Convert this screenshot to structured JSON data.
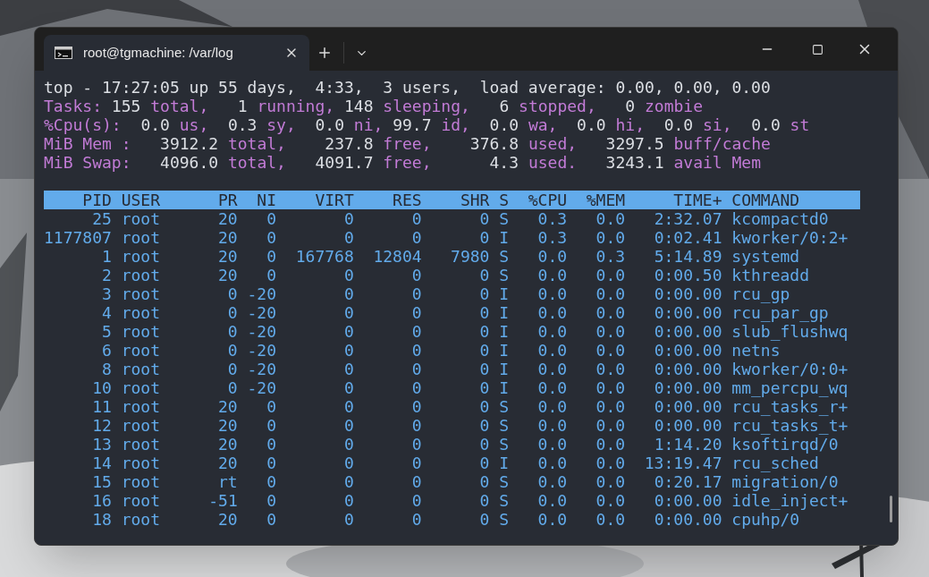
{
  "window": {
    "tab_title": "root@tgmachine: /var/log"
  },
  "summary": [
    {
      "segments": [
        {
          "kind": "value",
          "text": "top - 17:27:05 up 55 days,  4:33,  3 users,  load average: 0.00, 0.00, 0.00"
        }
      ]
    },
    {
      "segments": [
        {
          "kind": "label",
          "text": "Tasks:"
        },
        {
          "kind": "value",
          "text": " 155 "
        },
        {
          "kind": "label",
          "text": "total,"
        },
        {
          "kind": "value",
          "text": "   1 "
        },
        {
          "kind": "label",
          "text": "running,"
        },
        {
          "kind": "value",
          "text": " 148 "
        },
        {
          "kind": "label",
          "text": "sleeping,"
        },
        {
          "kind": "value",
          "text": "   6 "
        },
        {
          "kind": "label",
          "text": "stopped,"
        },
        {
          "kind": "value",
          "text": "   0 "
        },
        {
          "kind": "label",
          "text": "zombie"
        }
      ]
    },
    {
      "segments": [
        {
          "kind": "label",
          "text": "%Cpu(s):"
        },
        {
          "kind": "value",
          "text": "  0.0 "
        },
        {
          "kind": "label",
          "text": "us,"
        },
        {
          "kind": "value",
          "text": "  0.3 "
        },
        {
          "kind": "label",
          "text": "sy,"
        },
        {
          "kind": "value",
          "text": "  0.0 "
        },
        {
          "kind": "label",
          "text": "ni,"
        },
        {
          "kind": "value",
          "text": " 99.7 "
        },
        {
          "kind": "label",
          "text": "id,"
        },
        {
          "kind": "value",
          "text": "  0.0 "
        },
        {
          "kind": "label",
          "text": "wa,"
        },
        {
          "kind": "value",
          "text": "  0.0 "
        },
        {
          "kind": "label",
          "text": "hi,"
        },
        {
          "kind": "value",
          "text": "  0.0 "
        },
        {
          "kind": "label",
          "text": "si,"
        },
        {
          "kind": "value",
          "text": "  0.0 "
        },
        {
          "kind": "label",
          "text": "st"
        }
      ]
    },
    {
      "segments": [
        {
          "kind": "label",
          "text": "MiB Mem :"
        },
        {
          "kind": "value",
          "text": "   3912.2 "
        },
        {
          "kind": "label",
          "text": "total,"
        },
        {
          "kind": "value",
          "text": "    237.8 "
        },
        {
          "kind": "label",
          "text": "free,"
        },
        {
          "kind": "value",
          "text": "    376.8 "
        },
        {
          "kind": "label",
          "text": "used,"
        },
        {
          "kind": "value",
          "text": "   3297.5 "
        },
        {
          "kind": "label",
          "text": "buff/cache"
        }
      ]
    },
    {
      "segments": [
        {
          "kind": "label",
          "text": "MiB Swap:"
        },
        {
          "kind": "value",
          "text": "   4096.0 "
        },
        {
          "kind": "label",
          "text": "total,"
        },
        {
          "kind": "value",
          "text": "   4091.7 "
        },
        {
          "kind": "label",
          "text": "free,"
        },
        {
          "kind": "value",
          "text": "      4.3 "
        },
        {
          "kind": "label",
          "text": "used."
        },
        {
          "kind": "value",
          "text": "   3243.1 "
        },
        {
          "kind": "label",
          "text": "avail Mem"
        }
      ]
    }
  ],
  "table": {
    "columns": [
      "PID",
      "USER",
      "PR",
      "NI",
      "VIRT",
      "RES",
      "SHR",
      "S",
      "%CPU",
      "%MEM",
      "TIME+",
      "COMMAND"
    ],
    "rows": [
      [
        "25",
        "root",
        "20",
        "0",
        "0",
        "0",
        "0",
        "S",
        "0.3",
        "0.0",
        "2:32.07",
        "kcompactd0"
      ],
      [
        "1177807",
        "root",
        "20",
        "0",
        "0",
        "0",
        "0",
        "I",
        "0.3",
        "0.0",
        "0:02.41",
        "kworker/0:2+"
      ],
      [
        "1",
        "root",
        "20",
        "0",
        "167768",
        "12804",
        "7980",
        "S",
        "0.0",
        "0.3",
        "5:14.89",
        "systemd"
      ],
      [
        "2",
        "root",
        "20",
        "0",
        "0",
        "0",
        "0",
        "S",
        "0.0",
        "0.0",
        "0:00.50",
        "kthreadd"
      ],
      [
        "3",
        "root",
        "0",
        "-20",
        "0",
        "0",
        "0",
        "I",
        "0.0",
        "0.0",
        "0:00.00",
        "rcu_gp"
      ],
      [
        "4",
        "root",
        "0",
        "-20",
        "0",
        "0",
        "0",
        "I",
        "0.0",
        "0.0",
        "0:00.00",
        "rcu_par_gp"
      ],
      [
        "5",
        "root",
        "0",
        "-20",
        "0",
        "0",
        "0",
        "I",
        "0.0",
        "0.0",
        "0:00.00",
        "slub_flushwq"
      ],
      [
        "6",
        "root",
        "0",
        "-20",
        "0",
        "0",
        "0",
        "I",
        "0.0",
        "0.0",
        "0:00.00",
        "netns"
      ],
      [
        "8",
        "root",
        "0",
        "-20",
        "0",
        "0",
        "0",
        "I",
        "0.0",
        "0.0",
        "0:00.00",
        "kworker/0:0+"
      ],
      [
        "10",
        "root",
        "0",
        "-20",
        "0",
        "0",
        "0",
        "I",
        "0.0",
        "0.0",
        "0:00.00",
        "mm_percpu_wq"
      ],
      [
        "11",
        "root",
        "20",
        "0",
        "0",
        "0",
        "0",
        "S",
        "0.0",
        "0.0",
        "0:00.00",
        "rcu_tasks_r+"
      ],
      [
        "12",
        "root",
        "20",
        "0",
        "0",
        "0",
        "0",
        "S",
        "0.0",
        "0.0",
        "0:00.00",
        "rcu_tasks_t+"
      ],
      [
        "13",
        "root",
        "20",
        "0",
        "0",
        "0",
        "0",
        "S",
        "0.0",
        "0.0",
        "1:14.20",
        "ksoftirqd/0"
      ],
      [
        "14",
        "root",
        "20",
        "0",
        "0",
        "0",
        "0",
        "I",
        "0.0",
        "0.0",
        "13:19.47",
        "rcu_sched"
      ],
      [
        "15",
        "root",
        "rt",
        "0",
        "0",
        "0",
        "0",
        "S",
        "0.0",
        "0.0",
        "0:20.17",
        "migration/0"
      ],
      [
        "16",
        "root",
        "-51",
        "0",
        "0",
        "0",
        "0",
        "S",
        "0.0",
        "0.0",
        "0:00.00",
        "idle_inject+"
      ],
      [
        "18",
        "root",
        "20",
        "0",
        "0",
        "0",
        "0",
        "S",
        "0.0",
        "0.0",
        "0:00.00",
        "cpuhp/0"
      ]
    ]
  }
}
